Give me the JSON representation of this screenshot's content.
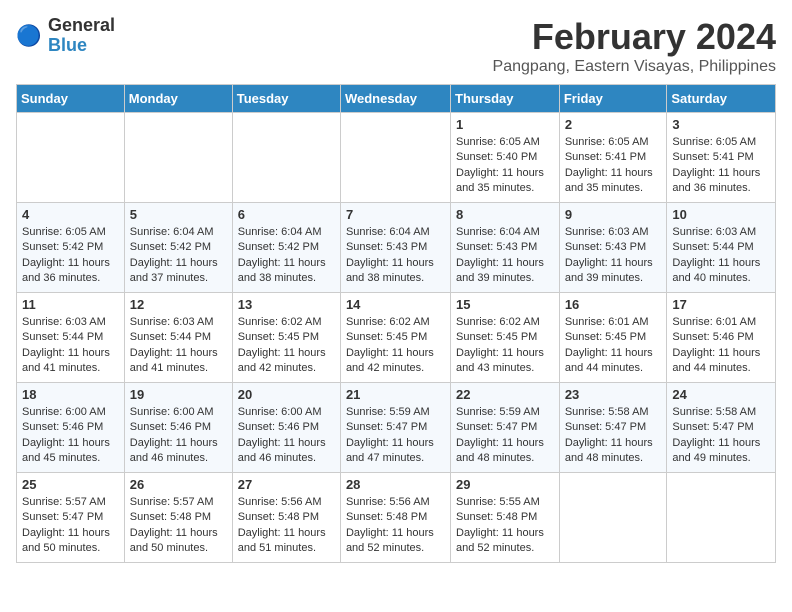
{
  "logo": {
    "line1": "General",
    "line2": "Blue"
  },
  "title": "February 2024",
  "subtitle": "Pangpang, Eastern Visayas, Philippines",
  "days_header": [
    "Sunday",
    "Monday",
    "Tuesday",
    "Wednesday",
    "Thursday",
    "Friday",
    "Saturday"
  ],
  "weeks": [
    [
      {
        "day": "",
        "text": ""
      },
      {
        "day": "",
        "text": ""
      },
      {
        "day": "",
        "text": ""
      },
      {
        "day": "",
        "text": ""
      },
      {
        "day": "1",
        "sunrise": "6:05 AM",
        "sunset": "5:40 PM",
        "daylight": "11 hours and 35 minutes."
      },
      {
        "day": "2",
        "sunrise": "6:05 AM",
        "sunset": "5:41 PM",
        "daylight": "11 hours and 35 minutes."
      },
      {
        "day": "3",
        "sunrise": "6:05 AM",
        "sunset": "5:41 PM",
        "daylight": "11 hours and 36 minutes."
      }
    ],
    [
      {
        "day": "4",
        "sunrise": "6:05 AM",
        "sunset": "5:42 PM",
        "daylight": "11 hours and 36 minutes."
      },
      {
        "day": "5",
        "sunrise": "6:04 AM",
        "sunset": "5:42 PM",
        "daylight": "11 hours and 37 minutes."
      },
      {
        "day": "6",
        "sunrise": "6:04 AM",
        "sunset": "5:42 PM",
        "daylight": "11 hours and 38 minutes."
      },
      {
        "day": "7",
        "sunrise": "6:04 AM",
        "sunset": "5:43 PM",
        "daylight": "11 hours and 38 minutes."
      },
      {
        "day": "8",
        "sunrise": "6:04 AM",
        "sunset": "5:43 PM",
        "daylight": "11 hours and 39 minutes."
      },
      {
        "day": "9",
        "sunrise": "6:03 AM",
        "sunset": "5:43 PM",
        "daylight": "11 hours and 39 minutes."
      },
      {
        "day": "10",
        "sunrise": "6:03 AM",
        "sunset": "5:44 PM",
        "daylight": "11 hours and 40 minutes."
      }
    ],
    [
      {
        "day": "11",
        "sunrise": "6:03 AM",
        "sunset": "5:44 PM",
        "daylight": "11 hours and 41 minutes."
      },
      {
        "day": "12",
        "sunrise": "6:03 AM",
        "sunset": "5:44 PM",
        "daylight": "11 hours and 41 minutes."
      },
      {
        "day": "13",
        "sunrise": "6:02 AM",
        "sunset": "5:45 PM",
        "daylight": "11 hours and 42 minutes."
      },
      {
        "day": "14",
        "sunrise": "6:02 AM",
        "sunset": "5:45 PM",
        "daylight": "11 hours and 42 minutes."
      },
      {
        "day": "15",
        "sunrise": "6:02 AM",
        "sunset": "5:45 PM",
        "daylight": "11 hours and 43 minutes."
      },
      {
        "day": "16",
        "sunrise": "6:01 AM",
        "sunset": "5:45 PM",
        "daylight": "11 hours and 44 minutes."
      },
      {
        "day": "17",
        "sunrise": "6:01 AM",
        "sunset": "5:46 PM",
        "daylight": "11 hours and 44 minutes."
      }
    ],
    [
      {
        "day": "18",
        "sunrise": "6:00 AM",
        "sunset": "5:46 PM",
        "daylight": "11 hours and 45 minutes."
      },
      {
        "day": "19",
        "sunrise": "6:00 AM",
        "sunset": "5:46 PM",
        "daylight": "11 hours and 46 minutes."
      },
      {
        "day": "20",
        "sunrise": "6:00 AM",
        "sunset": "5:46 PM",
        "daylight": "11 hours and 46 minutes."
      },
      {
        "day": "21",
        "sunrise": "5:59 AM",
        "sunset": "5:47 PM",
        "daylight": "11 hours and 47 minutes."
      },
      {
        "day": "22",
        "sunrise": "5:59 AM",
        "sunset": "5:47 PM",
        "daylight": "11 hours and 48 minutes."
      },
      {
        "day": "23",
        "sunrise": "5:58 AM",
        "sunset": "5:47 PM",
        "daylight": "11 hours and 48 minutes."
      },
      {
        "day": "24",
        "sunrise": "5:58 AM",
        "sunset": "5:47 PM",
        "daylight": "11 hours and 49 minutes."
      }
    ],
    [
      {
        "day": "25",
        "sunrise": "5:57 AM",
        "sunset": "5:47 PM",
        "daylight": "11 hours and 50 minutes."
      },
      {
        "day": "26",
        "sunrise": "5:57 AM",
        "sunset": "5:48 PM",
        "daylight": "11 hours and 50 minutes."
      },
      {
        "day": "27",
        "sunrise": "5:56 AM",
        "sunset": "5:48 PM",
        "daylight": "11 hours and 51 minutes."
      },
      {
        "day": "28",
        "sunrise": "5:56 AM",
        "sunset": "5:48 PM",
        "daylight": "11 hours and 52 minutes."
      },
      {
        "day": "29",
        "sunrise": "5:55 AM",
        "sunset": "5:48 PM",
        "daylight": "11 hours and 52 minutes."
      },
      {
        "day": "",
        "text": ""
      },
      {
        "day": "",
        "text": ""
      }
    ]
  ]
}
